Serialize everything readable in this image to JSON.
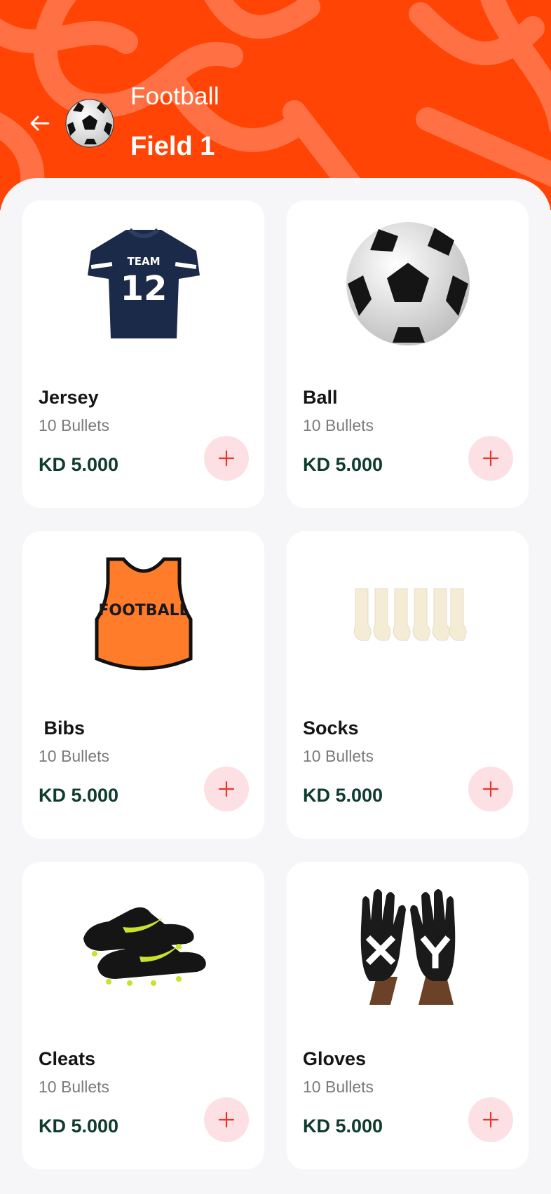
{
  "header": {
    "sport": "Football",
    "field": "Field 1",
    "accent_color": "#ff4406",
    "back_icon": "arrow-left-icon",
    "sport_icon": "soccer-ball-icon"
  },
  "products": [
    {
      "name": "Jersey",
      "subtitle": "10 Bullets",
      "price": "KD 5.000",
      "image": "jersey-image"
    },
    {
      "name": "Ball",
      "subtitle": "10 Bullets",
      "price": "KD 5.000",
      "image": "ball-image"
    },
    {
      "name": " Bibs",
      "subtitle": "10 Bullets",
      "price": "KD 5.000",
      "image": "bib-image"
    },
    {
      "name": "Socks",
      "subtitle": "10 Bullets",
      "price": "KD 5.000",
      "image": "socks-image"
    },
    {
      "name": "Cleats",
      "subtitle": "10 Bullets",
      "price": "KD 5.000",
      "image": "cleats-image"
    },
    {
      "name": "Gloves",
      "subtitle": "10 Bullets",
      "price": "KD 5.000",
      "image": "gloves-image"
    }
  ],
  "colors": {
    "price": "#0e3b2e",
    "add_button_bg": "#fde0e4",
    "add_icon": "#e8362c",
    "card_bg": "#ffffff",
    "page_bg": "#f6f5f8"
  },
  "images": {
    "jersey_text_top": "TEAM",
    "jersey_text_number": "12",
    "bib_text": "FOOTBALL"
  }
}
